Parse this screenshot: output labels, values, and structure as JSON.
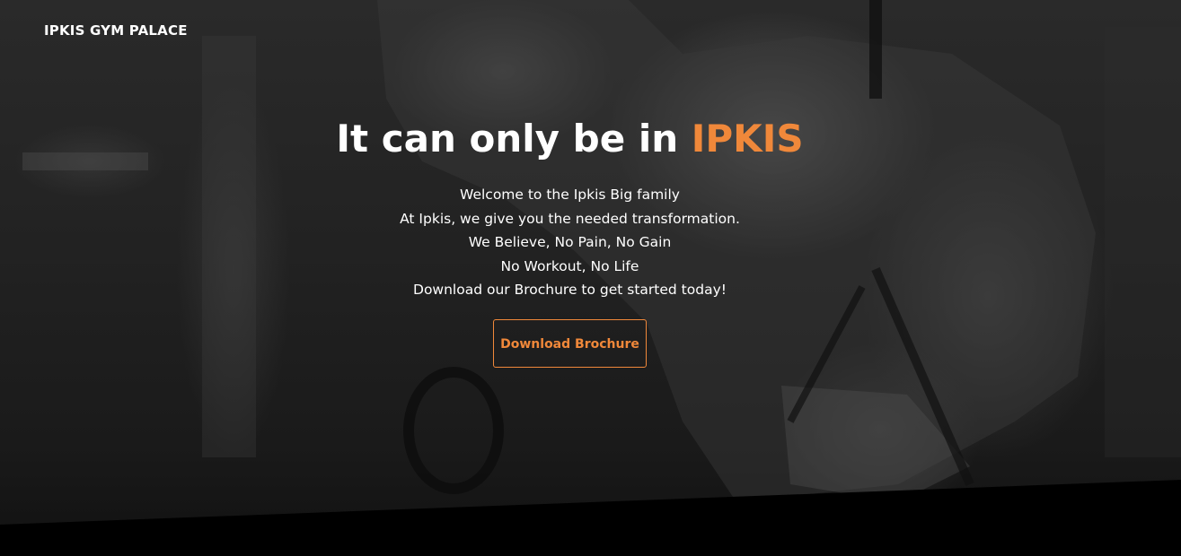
{
  "header": {
    "brand": "IPKIS GYM PALACE"
  },
  "hero": {
    "headline_prefix": "It can only be in ",
    "headline_accent": "IPKIS",
    "lines": [
      "Welcome to the Ipkis Big family",
      "At Ipkis, we give you the needed transformation.",
      "We Believe, No Pain, No Gain",
      "No Workout, No Life",
      "Download our Brochure to get started today!"
    ],
    "cta_label": "Download Brochure",
    "background_icon": "gym-photo"
  },
  "colors": {
    "accent": "#f0883a",
    "text": "#ffffff",
    "background": "#000000"
  }
}
